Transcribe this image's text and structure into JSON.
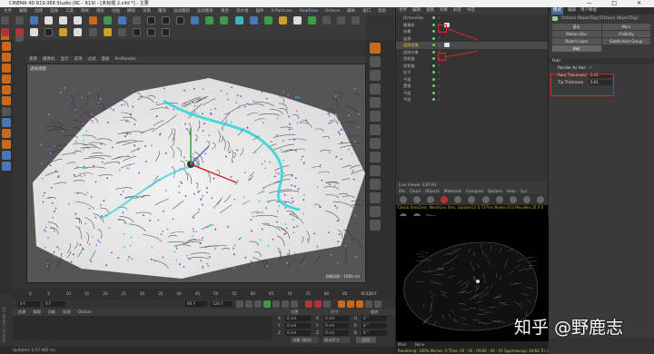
{
  "window": {
    "title": "CINEMA 4D R19.068 Studio (RC - R19) - [未标题 2.c4d *] - 主要",
    "controls": "— □ ✕"
  },
  "menubar": [
    "文件",
    "编辑",
    "创建",
    "选择",
    "工具",
    "网格",
    "捕捉",
    "动画",
    "模拟",
    "渲染",
    "雕刻",
    "运动跟踪",
    "运动图形",
    "角色",
    "流水线",
    "插件",
    "X-Particles",
    "RealFlow",
    "Octane",
    "脚本",
    "窗口",
    "帮助"
  ],
  "menubar_highlight": "RealFlow",
  "layout_label": "界面: Octane (用户)",
  "frame_counter": "F-16",
  "viewport": {
    "menu": [
      "查看",
      "摄像机",
      "显示",
      "选项",
      "过滤",
      "面板",
      "ProRender"
    ],
    "label": "透视视图",
    "scale": "网格间距 : 1000 cm"
  },
  "object_manager": {
    "menu": [
      "文件",
      "编辑",
      "查看",
      "对象",
      "标签",
      "书签"
    ],
    "objects": [
      {
        "name": "OctaneSky",
        "selected": false
      },
      {
        "name": "摄像机",
        "selected": false
      },
      {
        "name": "场景",
        "selected": false
      },
      {
        "name": "连接",
        "selected": false
      },
      {
        "name": "追踪对象",
        "selected": true
      },
      {
        "name": "追踪对象",
        "selected": false
      },
      {
        "name": "发射器",
        "selected": false
      },
      {
        "name": "发射器",
        "selected": false
      },
      {
        "name": "粒子",
        "selected": false
      },
      {
        "name": "平面",
        "selected": false
      },
      {
        "name": "置换",
        "selected": false
      },
      {
        "name": "平面",
        "selected": false
      },
      {
        "name": "平面",
        "selected": false
      }
    ]
  },
  "attributes": {
    "header": [
      "模式",
      "编辑",
      "用户数据"
    ],
    "title": "Octane ObjectTag [Octane ObjectTag]",
    "tabs": [
      "基本",
      "Main",
      "Motion Blur",
      "Visibility",
      "Object Layer",
      "Subdivision Group",
      "Hair"
    ],
    "active_tab": "Hair",
    "section": "Hair",
    "params": [
      {
        "label": "Render As Hair",
        "value": "✓"
      },
      {
        "label": "Root Thickness",
        "value": "0.01"
      },
      {
        "label": "Tip Thickness",
        "value": "0.01"
      }
    ]
  },
  "live_viewer": {
    "title": "Live Viewer 3.07-R2",
    "menu": [
      "File",
      "Cloud",
      "Objects",
      "Materials",
      "Compare",
      "Options",
      "Help",
      "Gui"
    ],
    "filter_label": "Filter",
    "status": "Check:0ms/2ms, MeshGen:0ms, Update[G]:0.737ms Nodes:414 Movable:20 0 0",
    "footer_left": "Main",
    "footer_right": "None",
    "footer_status": "Rendering: 100%   Ms/sec: 0   Time: 00 : 00 : 05/00 : 00 : 05   Spp/maxspp: 64/64   Tri: 0/2/0k"
  },
  "timeline": {
    "ticks": [
      "0",
      "5",
      "10",
      "15",
      "20",
      "25",
      "30",
      "35",
      "40",
      "45",
      "50",
      "55",
      "60",
      "65",
      "70",
      "75",
      "80",
      "85",
      "90"
    ],
    "end_label": "120 F",
    "start_field": "0 F",
    "current_field": "0 F",
    "end_field": "90 F",
    "max_field": "120 F"
  },
  "material_bar": [
    "创建",
    "编辑",
    "功能",
    "纹理",
    "Octane"
  ],
  "coordinates": {
    "headers": [
      "位置",
      "尺寸",
      "旋转"
    ],
    "rows": [
      {
        "axis": "X",
        "pos": "0 cm",
        "size": "0 cm",
        "rot_axis": "H",
        "rot": "0 °"
      },
      {
        "axis": "Y",
        "pos": "0 cm",
        "size": "0 cm",
        "rot_axis": "P",
        "rot": "0 °"
      },
      {
        "axis": "Z",
        "pos": "0 cm",
        "size": "0 cm",
        "rot_axis": "B",
        "rot": "0 °"
      }
    ],
    "mode": "对象 (相对)",
    "size_mode": "绝对尺寸",
    "apply": "应用"
  },
  "status_bar": "Updated: 0.57 466 ms",
  "brand": "MAXON CINEMA 4D",
  "watermark": "知乎 @野鹿志"
}
